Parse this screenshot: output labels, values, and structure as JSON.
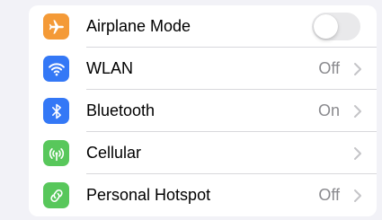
{
  "colors": {
    "airplane": "#f49a37",
    "wlan": "#3478f6",
    "bluetooth": "#3478f6",
    "cellular": "#58c75b",
    "hotspot": "#58c75b",
    "value_text": "#8a8a8e",
    "toggle_off": "#e9e9eb"
  },
  "settings": {
    "airplane": {
      "label": "Airplane Mode",
      "icon": "airplane-icon",
      "toggle_on": false
    },
    "wlan": {
      "label": "WLAN",
      "icon": "wifi-icon",
      "value": "Off"
    },
    "bluetooth": {
      "label": "Bluetooth",
      "icon": "bluetooth-icon",
      "value": "On"
    },
    "cellular": {
      "label": "Cellular",
      "icon": "antenna-icon",
      "value": ""
    },
    "hotspot": {
      "label": "Personal Hotspot",
      "icon": "hotspot-link-icon",
      "value": "Off"
    }
  }
}
